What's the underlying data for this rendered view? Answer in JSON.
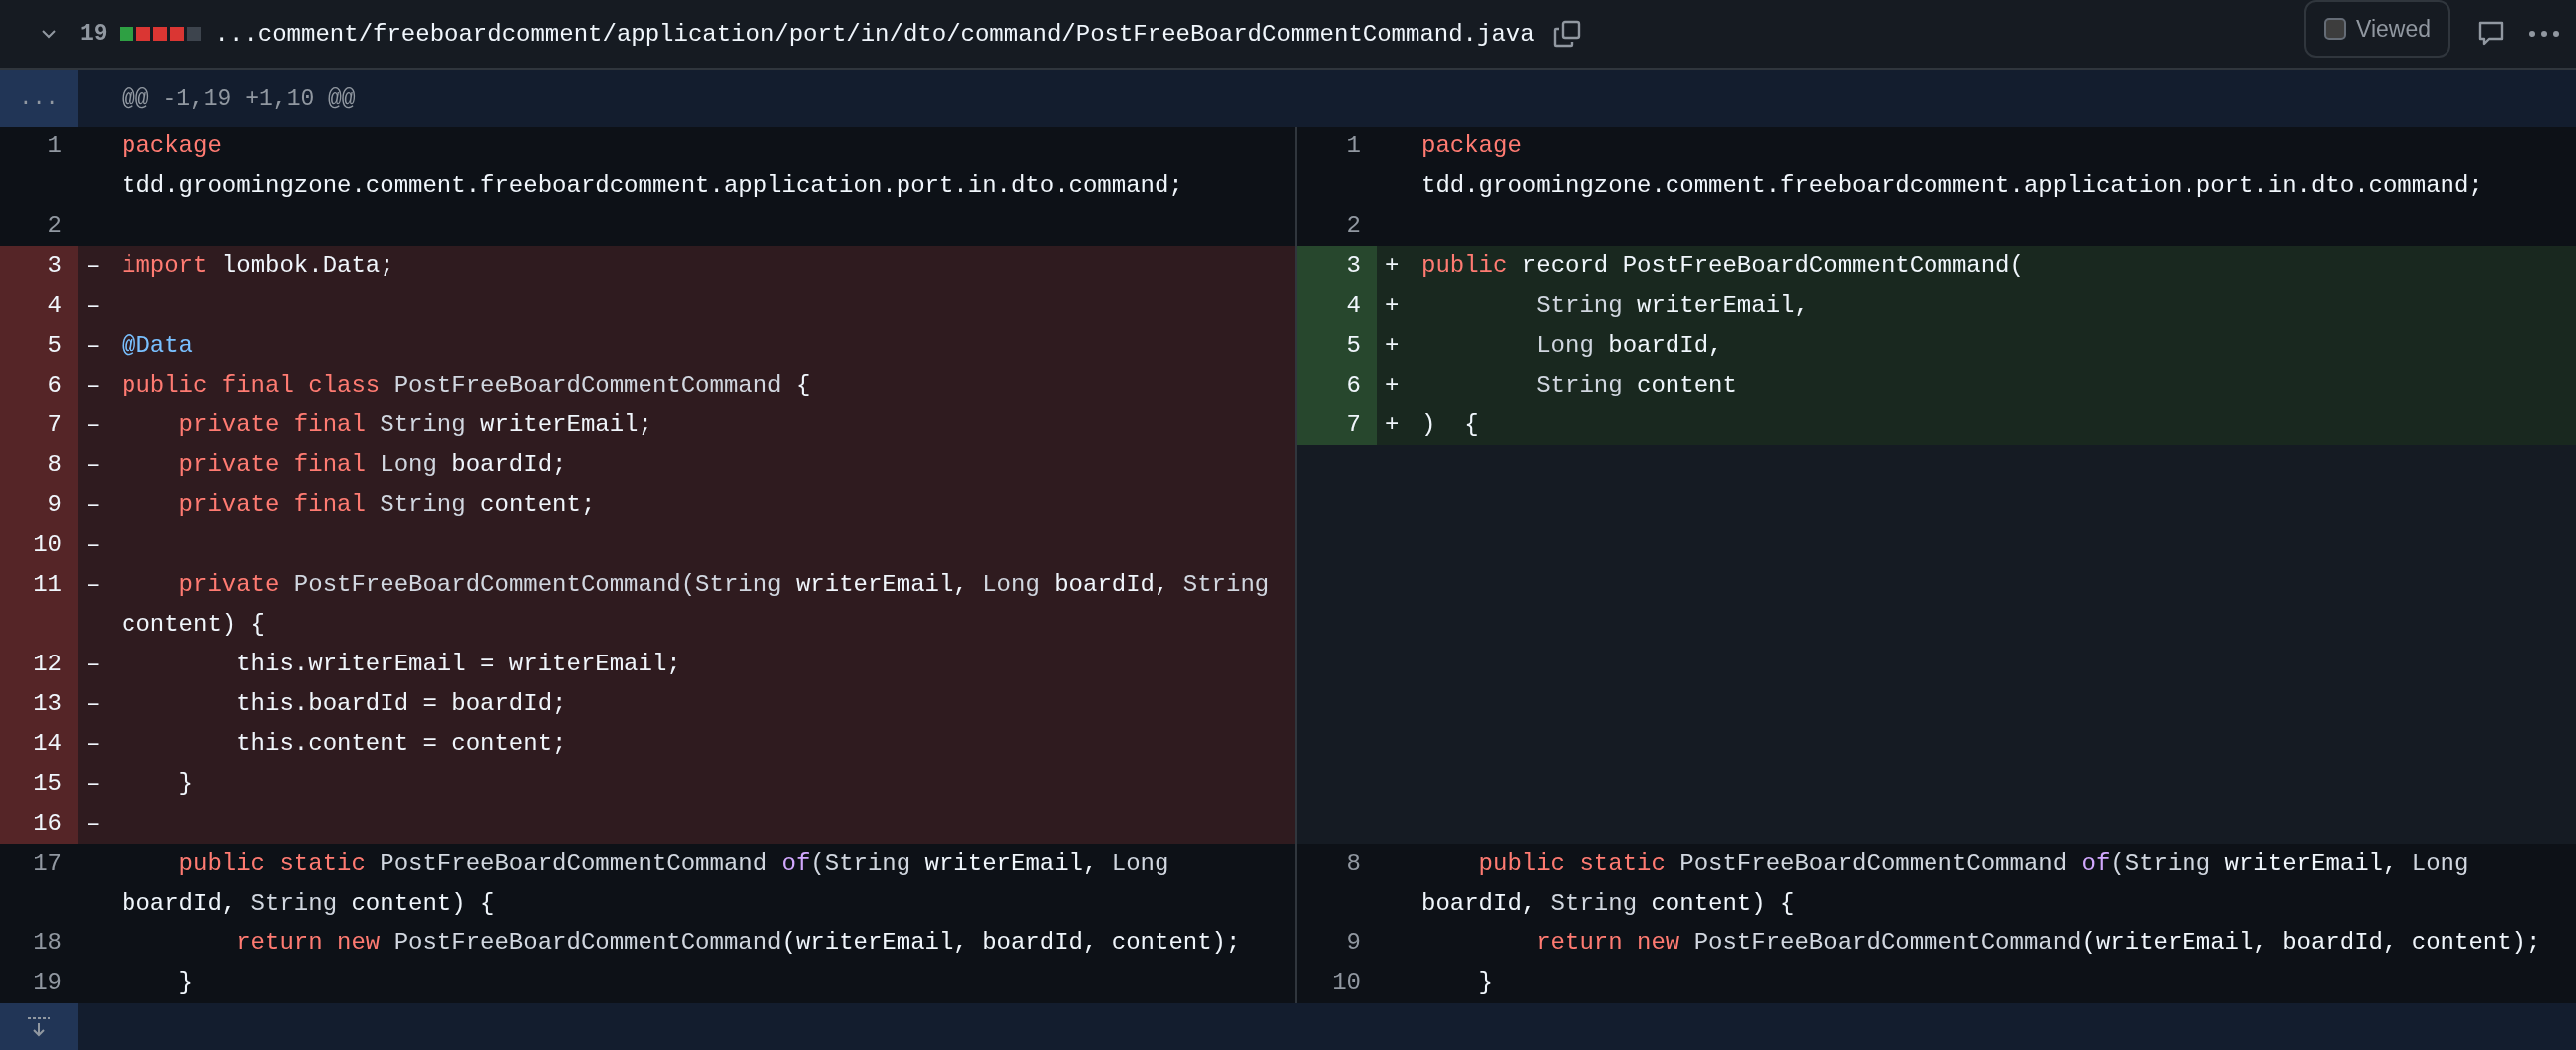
{
  "file": {
    "expanded": true,
    "changes": "19",
    "path": "...comment/freeboardcomment/application/port/in/dto/command/PostFreeBoardCommentCommand.java",
    "viewed_label": "Viewed",
    "viewed": false,
    "diffstat": [
      {
        "color": "#2ea043"
      },
      {
        "color": "#da3633"
      },
      {
        "color": "#da3633"
      },
      {
        "color": "#da3633"
      },
      {
        "color": "#3d444d"
      }
    ]
  },
  "hunk": {
    "expand_label": "...",
    "header": "@@ -1,19 +1,10 @@"
  },
  "rows": [
    {
      "left": {
        "kind": "context",
        "number": "1",
        "tokens": [
          {
            "kind": "keyword",
            "text": "package"
          },
          {
            "kind": "plain",
            "text": " tdd.groomingzone.comment.freeboardcomment.application.port.in.dto.command;"
          }
        ]
      },
      "right": {
        "kind": "context",
        "number": "1",
        "tokens": [
          {
            "kind": "keyword",
            "text": "package"
          },
          {
            "kind": "plain",
            "text": " tdd.groomingzone.comment.freeboardcomment.application.port.in.dto.command;"
          }
        ]
      }
    },
    {
      "left": {
        "kind": "context",
        "number": "2"
      },
      "right": {
        "kind": "context",
        "number": "2"
      }
    },
    {
      "left": {
        "kind": "deleted",
        "number": "3",
        "marker": "–",
        "tokens": [
          {
            "kind": "keyword",
            "text": "import"
          },
          {
            "kind": "plain",
            "text": " lombok.Data;"
          }
        ]
      },
      "right": {
        "kind": "added",
        "number": "3",
        "marker": "+",
        "tokens": [
          {
            "kind": "keyword",
            "text": "public"
          },
          {
            "kind": "plain",
            "text": " record PostFreeBoardCommentCommand("
          }
        ]
      }
    },
    {
      "left": {
        "kind": "deleted",
        "number": "4",
        "marker": "–"
      },
      "right": {
        "kind": "added",
        "number": "4",
        "marker": "+",
        "tokens": [
          {
            "kind": "type",
            "text": "        String"
          },
          {
            "kind": "plain",
            "text": " writerEmail,"
          }
        ]
      }
    },
    {
      "left": {
        "kind": "deleted",
        "number": "5",
        "marker": "–",
        "tokens": [
          {
            "kind": "annotation",
            "text": "@Data"
          }
        ]
      },
      "right": {
        "kind": "added",
        "number": "5",
        "marker": "+",
        "tokens": [
          {
            "kind": "type",
            "text": "        Long"
          },
          {
            "kind": "plain",
            "text": " boardId,"
          }
        ]
      }
    },
    {
      "left": {
        "kind": "deleted",
        "number": "6",
        "marker": "–",
        "tokens": [
          {
            "kind": "keyword",
            "text": "public final class"
          },
          {
            "kind": "type",
            "text": " PostFreeBoardCommentCommand"
          },
          {
            "kind": "plain",
            "text": " {"
          }
        ]
      },
      "right": {
        "kind": "added",
        "number": "6",
        "marker": "+",
        "tokens": [
          {
            "kind": "type",
            "text": "        String"
          },
          {
            "kind": "plain",
            "text": " content"
          }
        ]
      }
    },
    {
      "left": {
        "kind": "deleted",
        "number": "7",
        "marker": "–",
        "tokens": [
          {
            "kind": "keyword",
            "text": "    private final"
          },
          {
            "kind": "type",
            "text": " String"
          },
          {
            "kind": "plain",
            "text": " writerEmail;"
          }
        ]
      },
      "right": {
        "kind": "added",
        "number": "7",
        "marker": "+",
        "tokens": [
          {
            "kind": "plain",
            "text": ")  {"
          }
        ]
      }
    },
    {
      "left": {
        "kind": "deleted",
        "number": "8",
        "marker": "–",
        "tokens": [
          {
            "kind": "keyword",
            "text": "    private final"
          },
          {
            "kind": "type",
            "text": " Long"
          },
          {
            "kind": "plain",
            "text": " boardId;"
          }
        ]
      },
      "right": {
        "kind": "empty"
      }
    },
    {
      "left": {
        "kind": "deleted",
        "number": "9",
        "marker": "–",
        "tokens": [
          {
            "kind": "keyword",
            "text": "    private final"
          },
          {
            "kind": "type",
            "text": " String"
          },
          {
            "kind": "plain",
            "text": " content;"
          }
        ]
      },
      "right": {
        "kind": "empty"
      }
    },
    {
      "left": {
        "kind": "deleted",
        "number": "10",
        "marker": "–"
      },
      "right": {
        "kind": "empty"
      }
    },
    {
      "left": {
        "kind": "deleted",
        "number": "11",
        "marker": "–",
        "tokens": [
          {
            "kind": "keyword",
            "text": "    private"
          },
          {
            "kind": "type",
            "text": " PostFreeBoardCommentCommand(String"
          },
          {
            "kind": "plain",
            "text": " writerEmail,"
          },
          {
            "kind": "type",
            "text": " Long"
          },
          {
            "kind": "plain",
            "text": " boardId,"
          },
          {
            "kind": "type",
            "text": " String"
          },
          {
            "kind": "plain",
            "text": " content) {"
          }
        ]
      },
      "right": {
        "kind": "empty"
      }
    },
    {
      "left": {
        "kind": "deleted",
        "number": "12",
        "marker": "–",
        "tokens": [
          {
            "kind": "plain",
            "text": "        this.writerEmail = writerEmail;"
          }
        ]
      },
      "right": {
        "kind": "empty"
      }
    },
    {
      "left": {
        "kind": "deleted",
        "number": "13",
        "marker": "–",
        "tokens": [
          {
            "kind": "plain",
            "text": "        this.boardId = boardId;"
          }
        ]
      },
      "right": {
        "kind": "empty"
      }
    },
    {
      "left": {
        "kind": "deleted",
        "number": "14",
        "marker": "–",
        "tokens": [
          {
            "kind": "plain",
            "text": "        this.content = content;"
          }
        ]
      },
      "right": {
        "kind": "empty"
      }
    },
    {
      "left": {
        "kind": "deleted",
        "number": "15",
        "marker": "–",
        "tokens": [
          {
            "kind": "plain",
            "text": "    }"
          }
        ]
      },
      "right": {
        "kind": "empty"
      }
    },
    {
      "left": {
        "kind": "deleted",
        "number": "16",
        "marker": "–"
      },
      "right": {
        "kind": "empty"
      }
    },
    {
      "left": {
        "kind": "context",
        "number": "17",
        "tokens": [
          {
            "kind": "keyword",
            "text": "    public static"
          },
          {
            "kind": "type",
            "text": " PostFreeBoardCommentCommand"
          },
          {
            "kind": "entity",
            "text": " of"
          },
          {
            "kind": "type",
            "text": "(String"
          },
          {
            "kind": "plain",
            "text": " writerEmail,"
          },
          {
            "kind": "type",
            "text": " Long"
          },
          {
            "kind": "plain",
            "text": " boardId,"
          },
          {
            "kind": "type",
            "text": " String"
          },
          {
            "kind": "plain",
            "text": " content) {"
          }
        ]
      },
      "right": {
        "kind": "context",
        "number": "8",
        "tokens": [
          {
            "kind": "keyword",
            "text": "    public static"
          },
          {
            "kind": "type",
            "text": " PostFreeBoardCommentCommand"
          },
          {
            "kind": "entity",
            "text": " of"
          },
          {
            "kind": "type",
            "text": "(String"
          },
          {
            "kind": "plain",
            "text": " writerEmail,"
          },
          {
            "kind": "type",
            "text": " Long"
          },
          {
            "kind": "plain",
            "text": " boardId,"
          },
          {
            "kind": "type",
            "text": " String"
          },
          {
            "kind": "plain",
            "text": " content) {"
          }
        ]
      }
    },
    {
      "left": {
        "kind": "context",
        "number": "18",
        "tokens": [
          {
            "kind": "keyword",
            "text": "        return new"
          },
          {
            "kind": "type",
            "text": " PostFreeBoardCommentCommand"
          },
          {
            "kind": "plain",
            "text": "(writerEmail, boardId, content);"
          }
        ]
      },
      "right": {
        "kind": "context",
        "number": "9",
        "tokens": [
          {
            "kind": "keyword",
            "text": "        return new"
          },
          {
            "kind": "type",
            "text": " PostFreeBoardCommentCommand"
          },
          {
            "kind": "plain",
            "text": "(writerEmail, boardId, content);"
          }
        ]
      }
    },
    {
      "left": {
        "kind": "context",
        "number": "19",
        "tokens": [
          {
            "kind": "plain",
            "text": "    }"
          }
        ]
      },
      "right": {
        "kind": "context",
        "number": "10",
        "tokens": [
          {
            "kind": "plain",
            "text": "    }"
          }
        ]
      }
    }
  ]
}
